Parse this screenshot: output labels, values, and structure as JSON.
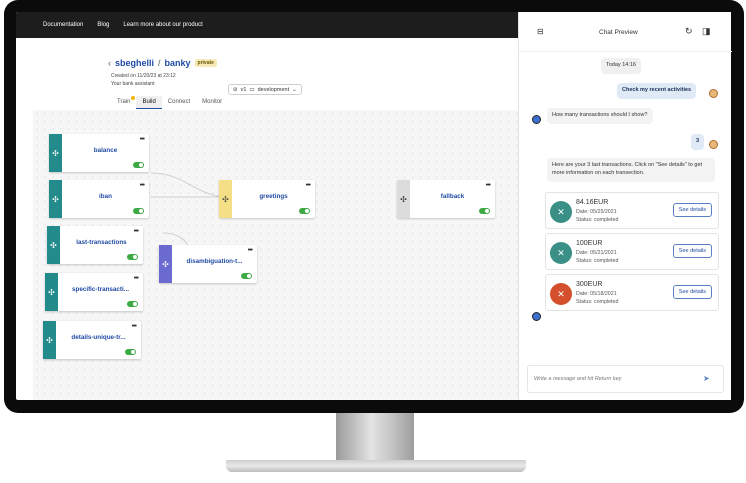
{
  "nav": {
    "items": [
      "Documentation",
      "Blog",
      "Learn more about our product"
    ]
  },
  "breadcrumb": {
    "user": "sbeghelli",
    "separator": "/",
    "project": "banky",
    "visibility": "private"
  },
  "version": {
    "tag": "v1",
    "env": "development"
  },
  "meta": {
    "created": "Created on 11/20/23 at 23:12",
    "description": "Your bank assistant"
  },
  "tabs": [
    "Train",
    "Build",
    "Connect",
    "Monitor"
  ],
  "nodes": {
    "balance": "balance",
    "iban": "iban",
    "last_transactions": "last-transactions",
    "specific_transactions": "specific-transacti...",
    "details_unique": "details-unique-tr...",
    "disambiguation": "disambiguation-t...",
    "greetings": "greetings",
    "fallback": "fallback"
  },
  "chat": {
    "title": "Chat Preview",
    "date": "Today 14:16",
    "user_msg_1": "Check my recent activities",
    "bot_msg_1": "How many transactions should I show?",
    "user_msg_2": "3",
    "bot_msg_2": "Here are your 3 last transactions. Click on \"See details\" to get more information on each transection.",
    "transactions": [
      {
        "amount": "84.16EUR",
        "date": "Date: 05/25/2021",
        "status": "Status: completed",
        "button": "See details",
        "color": "#3a8f86"
      },
      {
        "amount": "100EUR",
        "date": "Date: 05/21/2021",
        "status": "Status: completed",
        "button": "See details",
        "color": "#3a8f86"
      },
      {
        "amount": "300EUR",
        "date": "Date: 05/18/2021",
        "status": "Status: completed",
        "button": "See details",
        "color": "#d4502c"
      }
    ],
    "input_placeholder": "Write a message and hit Return key"
  }
}
